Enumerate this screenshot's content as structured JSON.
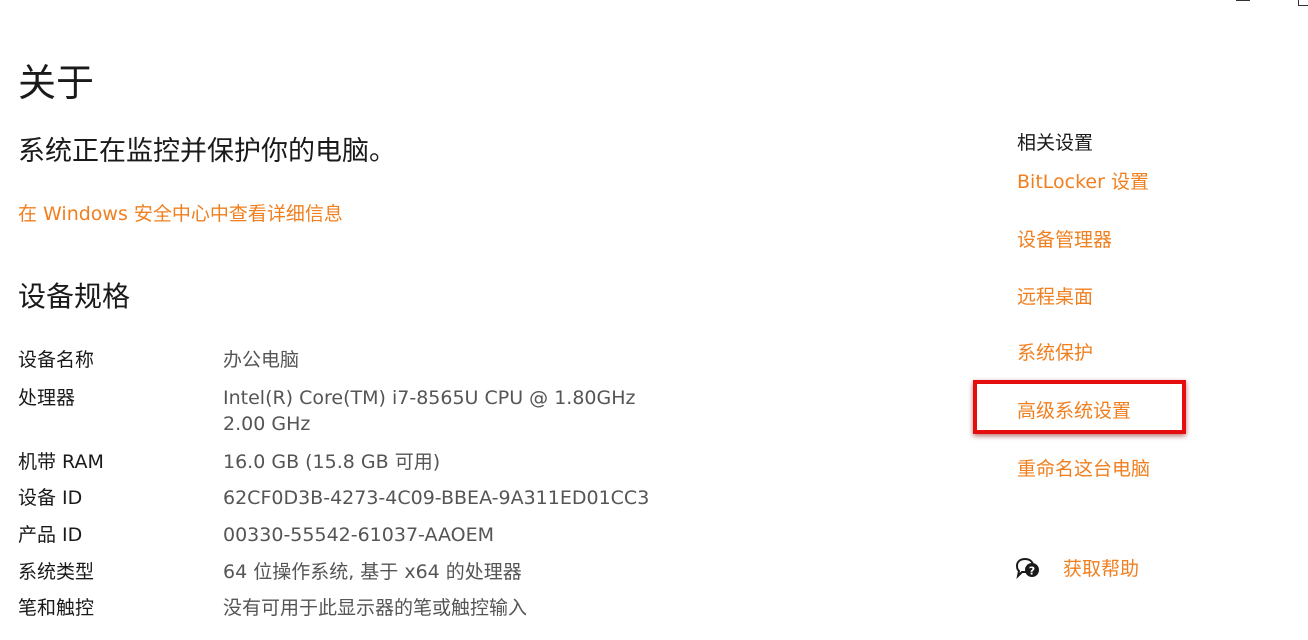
{
  "page": {
    "title": "关于",
    "status": "系统正在监控并保护你的电脑。",
    "security_link": "在 Windows 安全中心中查看详细信息",
    "specs_heading": "设备规格"
  },
  "specs": [
    {
      "label": "设备名称",
      "value": "办公电脑"
    },
    {
      "label": "处理器",
      "value": "Intel(R) Core(TM) i7-8565U CPU @ 1.80GHz   2.00 GHz"
    },
    {
      "label": "机带 RAM",
      "value": "16.0 GB (15.8 GB 可用)"
    },
    {
      "label": "设备 ID",
      "value": "62CF0D3B-4273-4C09-BBEA-9A311ED01CC3"
    },
    {
      "label": "产品 ID",
      "value": "00330-55542-61037-AAOEM"
    },
    {
      "label": "系统类型",
      "value": "64 位操作系统, 基于 x64 的处理器"
    },
    {
      "label": "笔和触控",
      "value": "没有可用于此显示器的笔或触控输入"
    }
  ],
  "related": {
    "heading": "相关设置",
    "links": [
      "BitLocker 设置",
      "设备管理器",
      "远程桌面",
      "系统保护",
      "高级系统设置",
      "重命名这台电脑"
    ],
    "highlighted": "高级系统设置"
  },
  "help": {
    "label": "获取帮助",
    "icon": "help-chat-icon"
  },
  "window_controls": {
    "icons": [
      "minimize-icon",
      "restore-icon"
    ]
  },
  "colors": {
    "link": "#f07f1f",
    "highlight": "#e50d0d",
    "value_text": "#555555",
    "text": "#1a1a1a"
  }
}
